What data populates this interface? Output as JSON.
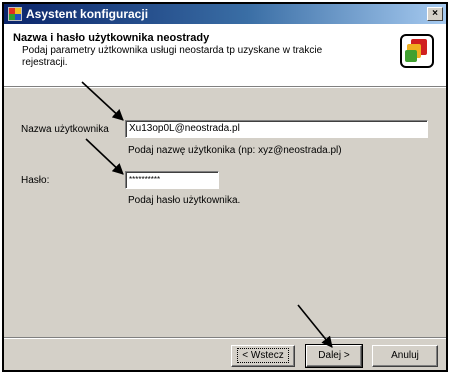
{
  "window": {
    "title": "Asystent konfiguracji",
    "close_glyph": "×"
  },
  "header": {
    "title": "Nazwa i hasło użytkownika neostrady",
    "description": "Podaj  parametry użtkownika usługi neostarda tp uzyskane w trakcie rejestracji.",
    "icon": "app-logo-icon"
  },
  "form": {
    "username_label": "Nazwa użytkownika",
    "username_value": "Xu13op0L@neostrada.pl",
    "username_hint": "Podaj nazwę użytkonika (np: xyz@neostrada.pl)",
    "password_label": "Hasło:",
    "password_value": "**********",
    "password_hint": "Podaj hasło użytkownika."
  },
  "buttons": {
    "back": "< Wstecz",
    "next": "Dalej >",
    "cancel": "Anuluj"
  },
  "colors": {
    "titlebar_start": "#0a246a",
    "titlebar_end": "#a6caf0",
    "dialog_bg": "#d4d0c8"
  }
}
